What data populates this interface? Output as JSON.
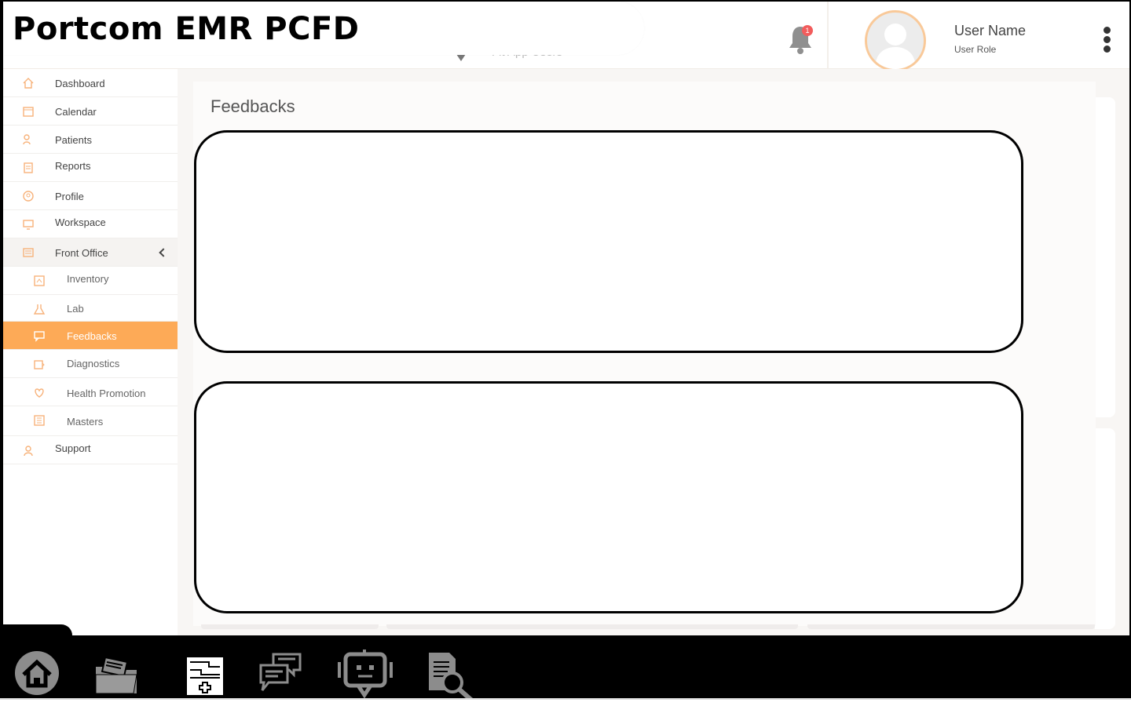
{
  "app": {
    "title": "Portcom EMR PCFD"
  },
  "header": {
    "ghost_text": "Fit App Users",
    "notification_count": "1",
    "user": {
      "name": "User Name",
      "role": "User Role"
    }
  },
  "sidebar": {
    "items": [
      {
        "label": "Dashboard",
        "icon": "home-icon"
      },
      {
        "label": "Calendar",
        "icon": "calendar-icon"
      },
      {
        "label": "Patients",
        "icon": "patients-icon"
      },
      {
        "label": "Reports",
        "icon": "reports-icon"
      },
      {
        "label": "Profile",
        "icon": "profile-icon"
      },
      {
        "label": "Workspace",
        "icon": "monitor-icon"
      },
      {
        "label": "Front Office",
        "icon": "front-office-icon",
        "expanded": true
      },
      {
        "label": "Inventory",
        "icon": "inventory-icon"
      },
      {
        "label": "Lab",
        "icon": "lab-icon"
      },
      {
        "label": "Feedbacks",
        "icon": "feedback-icon",
        "active": true
      },
      {
        "label": "Diagnostics",
        "icon": "diagnostics-icon"
      },
      {
        "label": "Health Promotion",
        "icon": "health-promotion-icon"
      },
      {
        "label": "Masters",
        "icon": "masters-icon"
      },
      {
        "label": "Support",
        "icon": "support-icon"
      }
    ]
  },
  "main": {
    "title": "Feedbacks"
  },
  "dock": {
    "items": [
      {
        "icon": "home-icon"
      },
      {
        "icon": "folder-icon"
      },
      {
        "icon": "medical-record-icon"
      },
      {
        "icon": "chat-icon"
      },
      {
        "icon": "robot-icon"
      },
      {
        "icon": "document-search-icon"
      }
    ]
  },
  "colors": {
    "accent": "#fdaa57",
    "icon": "#f7b27a",
    "badge": "#f25c5c"
  }
}
